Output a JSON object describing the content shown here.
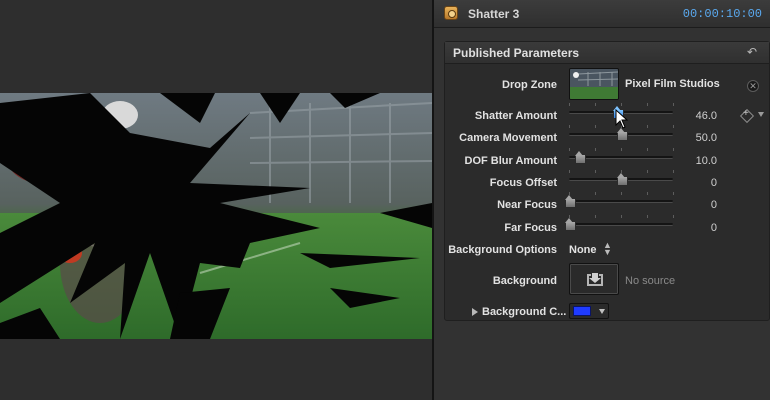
{
  "inspector": {
    "clip_title": "Shatter 3",
    "timecode": "00:00:10:00",
    "panel_title": "Published Parameters"
  },
  "drop_zone": {
    "label": "Drop Zone",
    "source": "Pixel Film Studios"
  },
  "parameters": [
    {
      "label": "Shatter Amount",
      "value": "46.0",
      "fraction": 0.46
    },
    {
      "label": "Camera Movement",
      "value": "50.0",
      "fraction": 0.5
    },
    {
      "label": "DOF Blur Amount",
      "value": "10.0",
      "fraction": 0.1
    },
    {
      "label": "Focus Offset",
      "value": "0",
      "fraction": 0.5
    },
    {
      "label": "Near Focus",
      "value": "0",
      "fraction": 0.0
    },
    {
      "label": "Far Focus",
      "value": "0",
      "fraction": 0.0
    }
  ],
  "background_options": {
    "label": "Background Options",
    "value": "None"
  },
  "background": {
    "label": "Background",
    "placeholder": "No source"
  },
  "background_color": {
    "label": "Background C...",
    "color": "#1f3bff"
  },
  "icons": {
    "clip": "effect-clip-icon",
    "reset": "reset-icon",
    "clear": "clear-icon",
    "keyframe": "add-keyframe-icon",
    "disclosure": "disclosure-triangle-icon",
    "drop_target": "drop-target-icon",
    "cursor": "pointer-cursor-icon"
  },
  "colors": {
    "timecode": "#5aa9ef",
    "active_slider": "#2f7fe0"
  }
}
